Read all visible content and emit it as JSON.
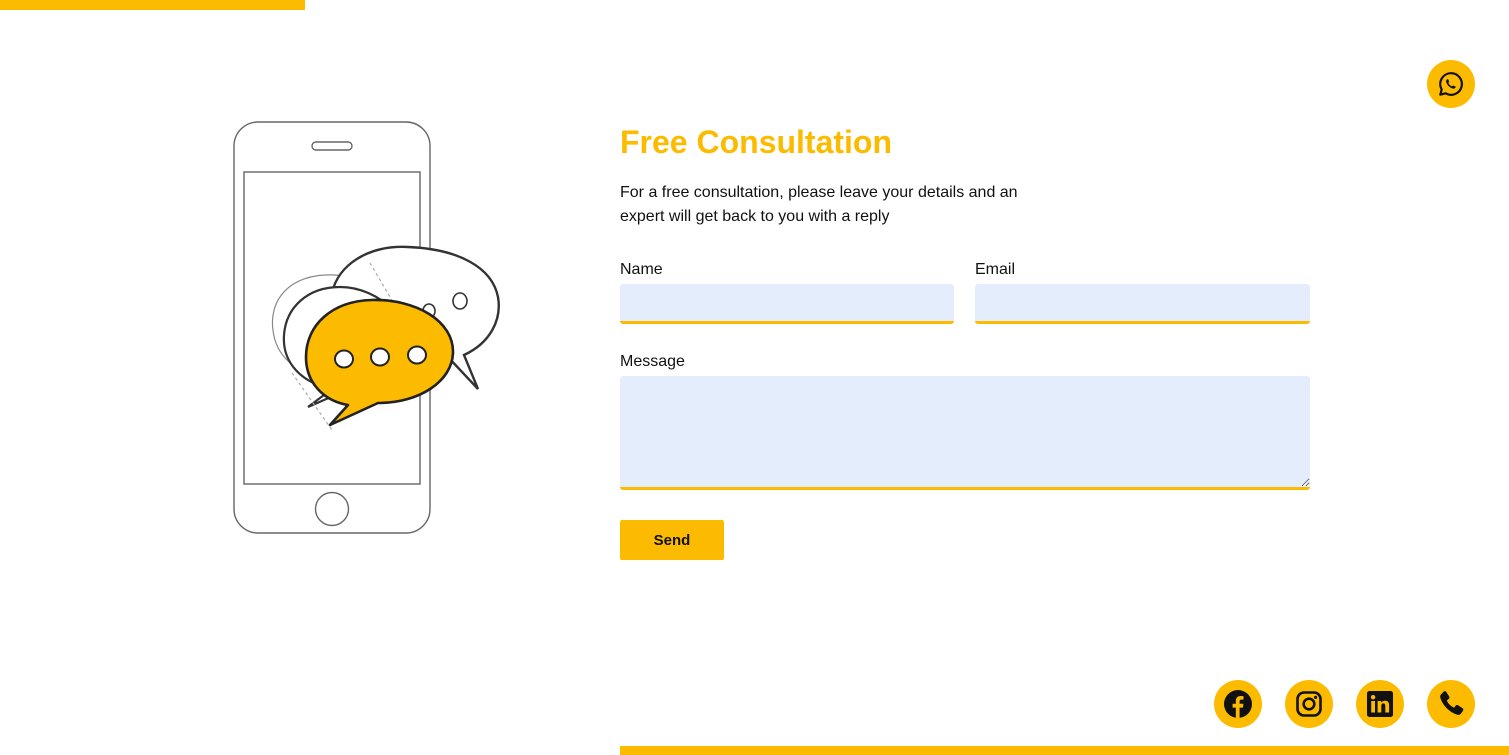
{
  "colors": {
    "accent": "#fdbb00",
    "input_bg": "#e4edfc",
    "text": "#111111"
  },
  "contact": {
    "title": "Free Consultation",
    "intro": "For a free consultation, please leave your details and an expert will get back to you with a reply",
    "fields": {
      "name_label": "Name",
      "name_value": "",
      "email_label": "Email",
      "email_value": "",
      "message_label": "Message",
      "message_value": ""
    },
    "send_label": "Send"
  },
  "icons": {
    "floating": "whatsapp-icon",
    "social": [
      "facebook-icon",
      "instagram-icon",
      "linkedin-icon",
      "phone-icon"
    ],
    "illustration": "phone-chat-bubbles-illustration"
  }
}
